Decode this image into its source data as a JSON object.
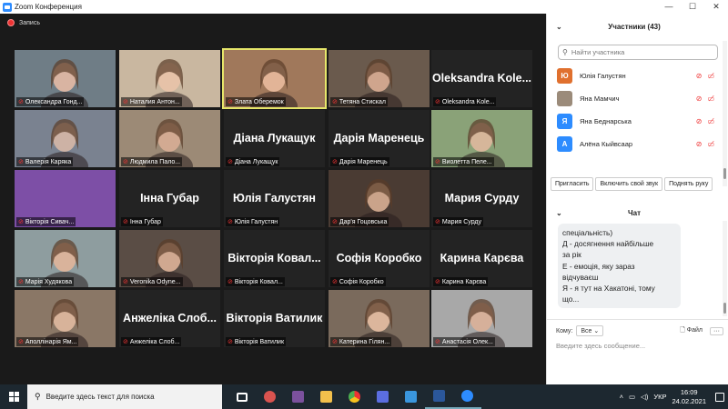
{
  "window": {
    "title": "Zoom Конференция",
    "controls": [
      "—",
      "☐",
      "✕"
    ]
  },
  "recording": {
    "label": "Запись"
  },
  "tiles": [
    {
      "name": "Олександра Гонд...",
      "type": "video",
      "bg": "#6f7d86",
      "skin": "#d9b4a2"
    },
    {
      "name": "Наталия Антон...",
      "type": "video",
      "bg": "#c9b7a0",
      "skin": "#e6c2a8"
    },
    {
      "name": "Злата Оберемок",
      "type": "video",
      "bg": "#a0785b",
      "skin": "#e2b497",
      "active": true
    },
    {
      "name": "Тетяна Стискал",
      "type": "video",
      "bg": "#6a5a4d",
      "skin": "#cfa58d"
    },
    {
      "name": "Oleksandra Kole...",
      "type": "name",
      "big": "Oleksandra  Kole..."
    },
    {
      "name": "Валерія Каряка",
      "type": "video",
      "bg": "#7a8290",
      "skin": "#cdb2a5"
    },
    {
      "name": "Людмила Пало...",
      "type": "video",
      "bg": "#9c8a76",
      "skin": "#d2aa92"
    },
    {
      "name": "Діана Лукащук",
      "type": "name",
      "big": "Діана Лукащук"
    },
    {
      "name": "Дарія Маренець",
      "type": "name",
      "big": "Дарія Маренець"
    },
    {
      "name": "Виолетта Пеле...",
      "type": "video",
      "bg": "#8aa278",
      "skin": "#d6b69a"
    },
    {
      "name": "Вікторія Сивач...",
      "type": "video",
      "bg": "#7d4fa6",
      "skin": "#7d4fa6"
    },
    {
      "name": "Інна Губар",
      "type": "name",
      "big": "Інна Губар"
    },
    {
      "name": "Юлія Галустян",
      "type": "name",
      "big": "Юлія Галустян"
    },
    {
      "name": "Дар'я Гоцовська",
      "type": "video",
      "bg": "#4a3b33",
      "skin": "#caa38a"
    },
    {
      "name": "Мария Сурду",
      "type": "name",
      "big": "Мария Сурду"
    },
    {
      "name": "Марія Худякова",
      "type": "video",
      "bg": "#8e9d9f",
      "skin": "#d9b39b"
    },
    {
      "name": "Veronika Odyne...",
      "type": "video",
      "bg": "#5a4d45",
      "skin": "#d0a890"
    },
    {
      "name": "Вікторія Ковал...",
      "type": "name",
      "big": "Вікторія Ковал..."
    },
    {
      "name": "Софія Коробко",
      "type": "name",
      "big": "Софія Коробко"
    },
    {
      "name": "Карина Карєва",
      "type": "name",
      "big": "Карина Карєва"
    },
    {
      "name": "Аполлінарія Ям...",
      "type": "video",
      "bg": "#8a7766",
      "skin": "#d8b39a"
    },
    {
      "name": "Анжеліка Слоб...",
      "type": "name",
      "big": "Анжеліка Слоб..."
    },
    {
      "name": "Вікторія Ватилик",
      "type": "name",
      "big": "Вікторія Ватилик"
    },
    {
      "name": "Катерина Гілян...",
      "type": "video",
      "bg": "#7a6a5c",
      "skin": "#dcb69c"
    },
    {
      "name": "Анастасія Олек...",
      "type": "video",
      "bg": "#a8a8a8",
      "skin": "#d6b09a"
    }
  ],
  "participants_panel": {
    "title": "Участники (43)",
    "search_placeholder": "Найти участника",
    "items": [
      {
        "initial": "Ю",
        "name": "Юлія Галустян",
        "color": "#e0702e"
      },
      {
        "initial": "",
        "name": "Яна Мамчич",
        "color": "#9b8b7a"
      },
      {
        "initial": "Я",
        "name": "Яна Беднарська",
        "color": "#2d8cff"
      },
      {
        "initial": "А",
        "name": "Алёна Кыйвсаар",
        "color": "#2d8cff"
      }
    ],
    "buttons": [
      "Пригласить",
      "Включить свой звук",
      "Поднять руку"
    ]
  },
  "chat": {
    "title": "Чат",
    "lines": [
      "спеціальність)",
      "Д - досягнення найбільше",
      "за рік",
      "Е - емоція, яку зараз",
      "відчуваєш",
      "Я - я тут на Хакатоні, тому",
      "що..."
    ],
    "to_label": "Кому:",
    "to_value": "Все",
    "file_label": "Файл",
    "input_placeholder": "Введите здесь сообщение..."
  },
  "taskbar": {
    "search_text": "Введите здесь текст для поиска",
    "apps": [
      {
        "name": "task-view-icon",
        "color": "#ffffff"
      },
      {
        "name": "app-red-icon",
        "color": "#d9534f"
      },
      {
        "name": "viber-icon",
        "color": "#7b519d"
      },
      {
        "name": "file-explorer-icon",
        "color": "#f2c04c"
      },
      {
        "name": "chrome-icon",
        "color": "#4caf50"
      },
      {
        "name": "store-icon",
        "color": "#5b6ee1"
      },
      {
        "name": "photos-icon",
        "color": "#3a96dd"
      },
      {
        "name": "word-icon",
        "color": "#2b579a"
      },
      {
        "name": "zoom-icon",
        "color": "#2d8cff"
      }
    ],
    "language": "УКР",
    "time": "16:09",
    "date": "24.02.2021"
  }
}
